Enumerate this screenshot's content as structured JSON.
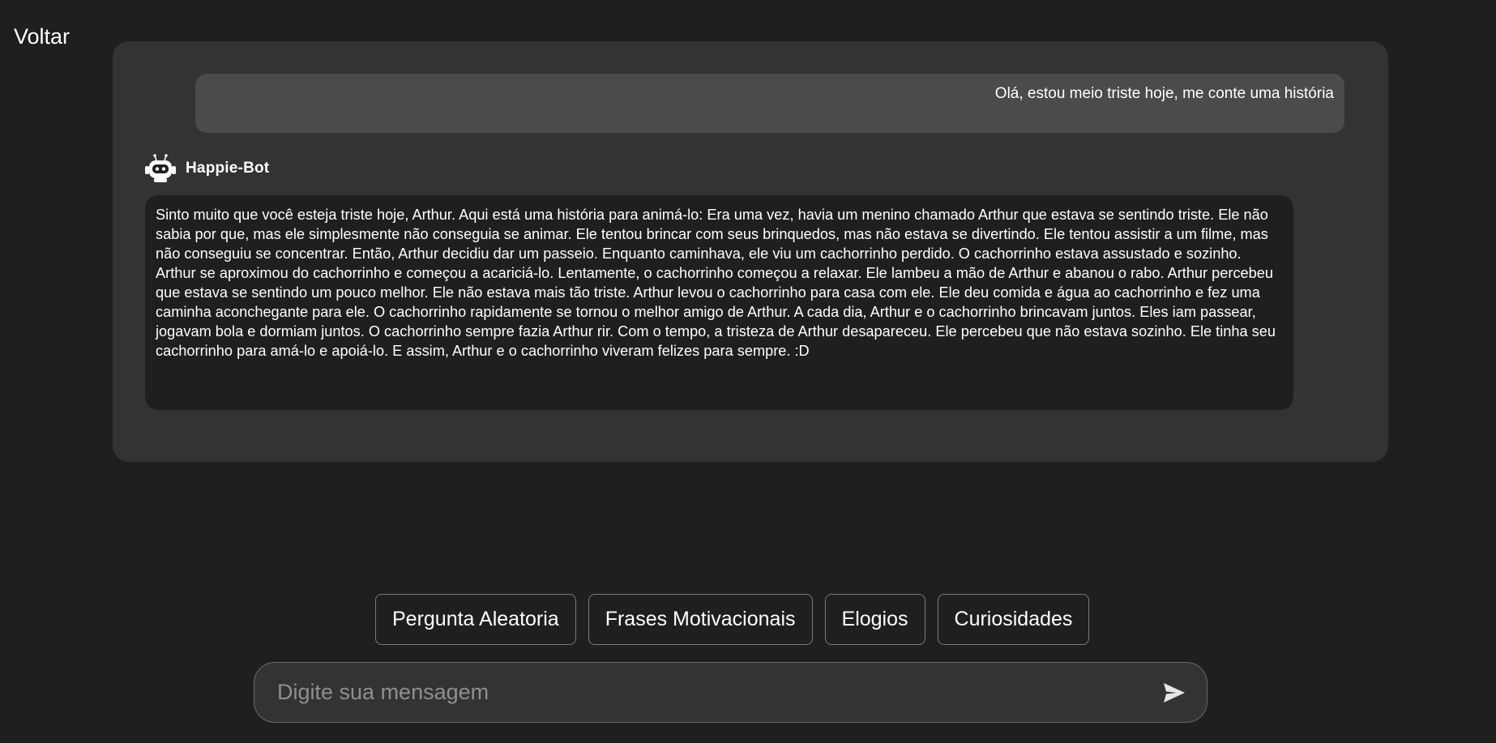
{
  "nav": {
    "back_label": "Voltar"
  },
  "chat": {
    "user_message": "Olá, estou meio triste hoje, me conte uma história",
    "bot_name": "Happie-Bot",
    "bot_avatar_icon": "robot-icon",
    "bot_message": "Sinto muito que você esteja triste hoje, Arthur. Aqui está uma história para animá-lo: Era uma vez, havia um menino chamado Arthur que estava se sentindo triste. Ele não sabia por que, mas ele simplesmente não conseguia se animar. Ele tentou brincar com seus brinquedos, mas não estava se divertindo. Ele tentou assistir a um filme, mas não conseguiu se concentrar. Então, Arthur decidiu dar um passeio. Enquanto caminhava, ele viu um cachorrinho perdido. O cachorrinho estava assustado e sozinho. Arthur se aproximou do cachorrinho e começou a acariciá-lo. Lentamente, o cachorrinho começou a relaxar. Ele lambeu a mão de Arthur e abanou o rabo. Arthur percebeu que estava se sentindo um pouco melhor. Ele não estava mais tão triste. Arthur levou o cachorrinho para casa com ele. Ele deu comida e água ao cachorrinho e fez uma caminha aconchegante para ele. O cachorrinho rapidamente se tornou o melhor amigo de Arthur. A cada dia, Arthur e o cachorrinho brincavam juntos. Eles iam passear, jogavam bola e dormiam juntos. O cachorrinho sempre fazia Arthur rir. Com o tempo, a tristeza de Arthur desapareceu. Ele percebeu que não estava sozinho. Ele tinha seu cachorrinho para amá-lo e apoiá-lo. E assim, Arthur e o cachorrinho viveram felizes para sempre. :D"
  },
  "quick_actions": [
    {
      "label": "Pergunta Aleatoria"
    },
    {
      "label": "Frases Motivacionais"
    },
    {
      "label": "Elogios"
    },
    {
      "label": "Curiosidades"
    }
  ],
  "composer": {
    "placeholder": "Digite sua mensagem",
    "send_icon": "send-icon"
  },
  "colors": {
    "background": "#1f1f1f",
    "panel": "#333333",
    "user_bubble": "#4b4b4b",
    "bot_bubble": "#1f1f1f",
    "text": "#ffffff",
    "placeholder": "#8f8f8f"
  }
}
